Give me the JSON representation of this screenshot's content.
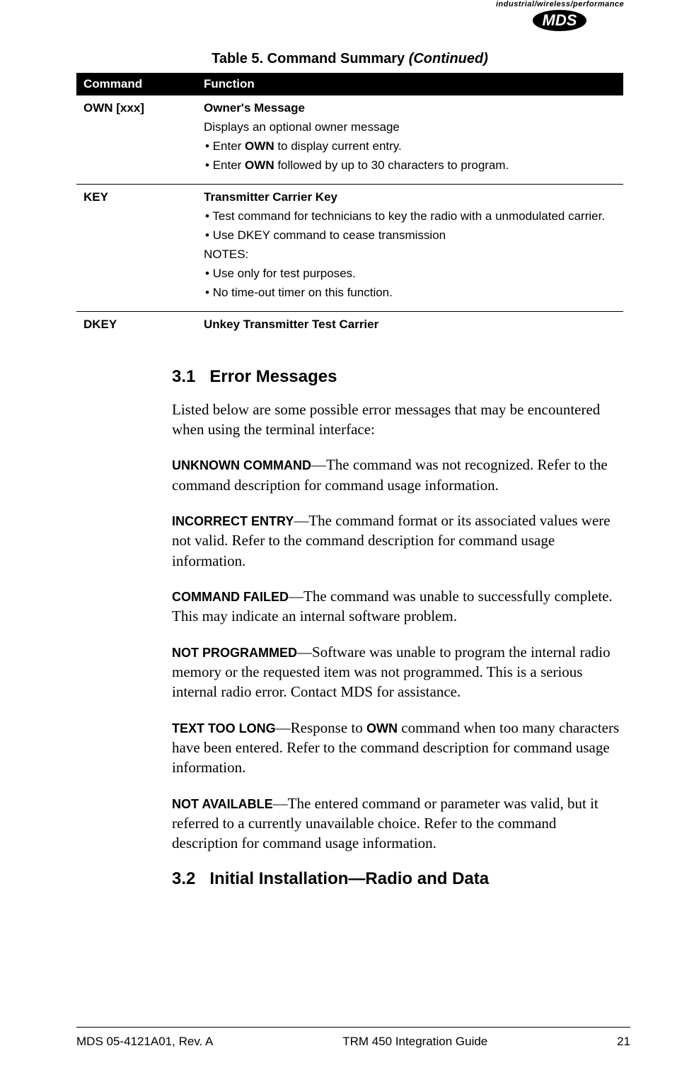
{
  "logo": {
    "tagline": "industrial/wireless/performance",
    "brand": "MDS"
  },
  "table": {
    "title_prefix": "Table 5. Command Summary ",
    "title_suffix": "(Continued)",
    "headers": {
      "command": "Command",
      "function": "Function"
    },
    "rows": {
      "own": {
        "cmd": "OWN [xxx]",
        "title": "Owner's Message",
        "l1": "Displays an optional owner message",
        "b1a": "Enter ",
        "b1b": "OWN",
        "b1c": " to display current entry.",
        "b2a": "Enter ",
        "b2b": "OWN",
        "b2c": " followed by up to 30 characters to program."
      },
      "key": {
        "cmd": "KEY",
        "title": "Transmitter Carrier Key",
        "b1": "Test command for technicians to key the radio with a unmodulated carrier.",
        "b2": "Use DKEY command to cease transmission",
        "notes": "NOTES:",
        "b3": "Use only for test purposes.",
        "b4": "No time-out timer on this function."
      },
      "dkey": {
        "cmd": "DKEY",
        "title": "Unkey Transmitter Test Carrier"
      }
    }
  },
  "sections": {
    "s1": {
      "num": "3.1",
      "title": "Error Messages"
    },
    "s2": {
      "num": "3.2",
      "title": "Initial Installation—Radio and Data"
    }
  },
  "body": {
    "intro": "Listed below are some possible error messages that may be encountered when using the terminal interface:"
  },
  "errors": {
    "e1": {
      "name": "UNKNOWN COMMAND",
      "desc": "—The command was not recognized. Refer to the command description for command usage information."
    },
    "e2": {
      "name": "INCORRECT ENTRY",
      "desc": "—The command format or its associated values were not valid. Refer to the command description for command usage information."
    },
    "e3": {
      "name": "COMMAND FAILED",
      "desc": "—The command was unable to successfully complete. This may indicate an internal software problem."
    },
    "e4": {
      "name": "NOT PROGRAMMED",
      "desc": "—Software was unable to program the internal radio memory or the requested item was not programmed. This is a serious internal radio error. Contact MDS for assistance."
    },
    "e5": {
      "name": "TEXT TOO LONG",
      "desc_a": "—Response to ",
      "cmd": "OWN",
      "desc_b": " command when too many characters have been entered. Refer to the command description for command usage information."
    },
    "e6": {
      "name": "NOT AVAILABLE",
      "desc": "—The entered command or parameter was valid, but it referred to a currently unavailable choice. Refer to the command description for command usage information."
    }
  },
  "footer": {
    "left": "MDS 05-4121A01, Rev. A",
    "center": "TRM 450 Integration Guide",
    "right": "21"
  }
}
